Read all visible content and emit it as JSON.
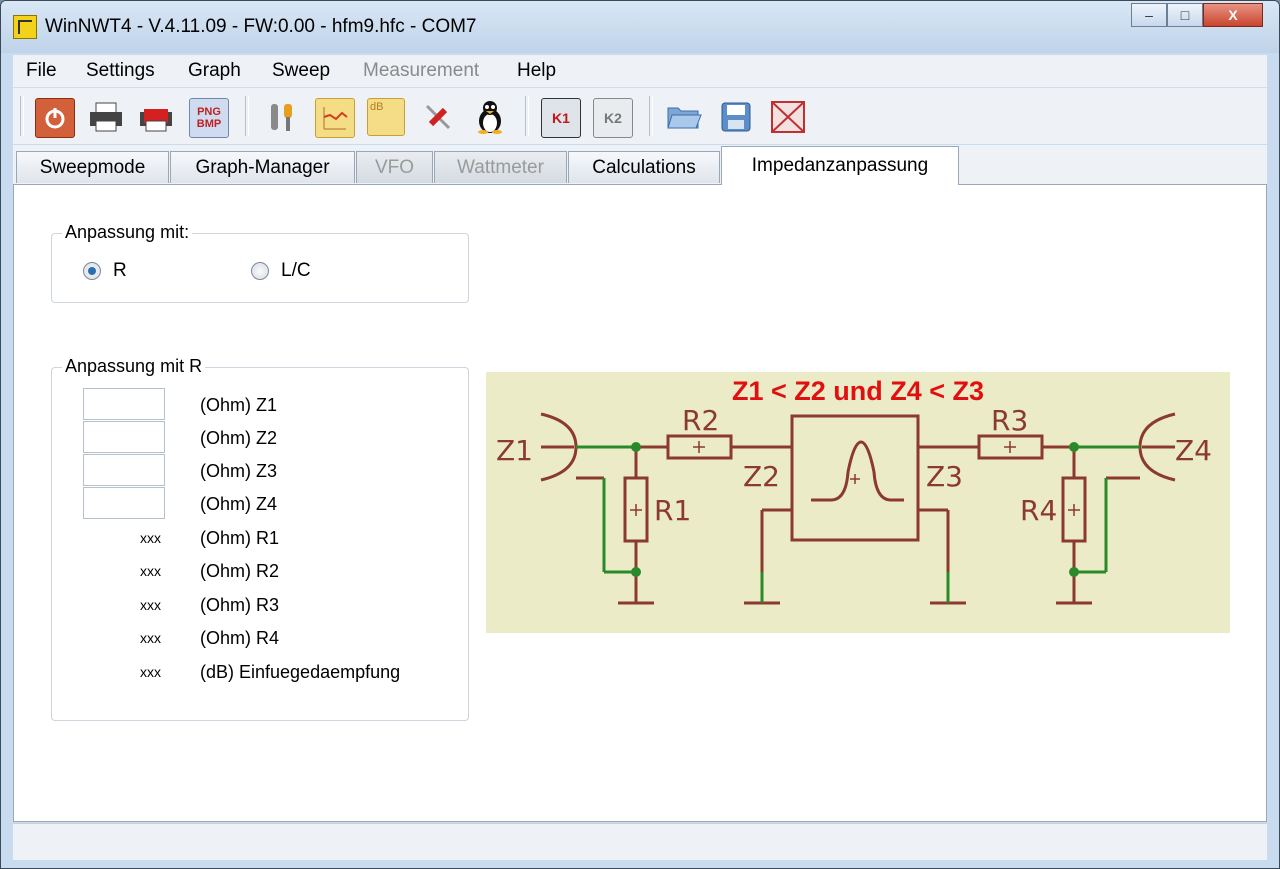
{
  "window": {
    "title": "WinNWT4 - V.4.11.09 - FW:0.00 - hfm9.hfc - COM7",
    "controls": {
      "minimize": "–",
      "maximize": "□",
      "close": "X"
    }
  },
  "menu": [
    "File",
    "Settings",
    "Graph",
    "Sweep",
    "Measurement",
    "Help"
  ],
  "toolbar": {
    "icons": [
      "power-icon",
      "printer-icon",
      "pdf-icon",
      "png-bmp-icon",
      "tools-icon",
      "graph-icon",
      "db-icon",
      "screwdriver-icon",
      "linux-icon",
      "k1-icon",
      "k2-icon",
      "open-folder-icon",
      "save-icon",
      "calibrate-icon"
    ],
    "png_label": "PNG",
    "bmp_label": "BMP",
    "db_label": "dB",
    "k1_label": "K1",
    "k2_label": "K2"
  },
  "tabs": [
    {
      "label": "Sweepmode",
      "state": "normal"
    },
    {
      "label": "Graph-Manager",
      "state": "normal"
    },
    {
      "label": "VFO",
      "state": "disabled"
    },
    {
      "label": "Wattmeter",
      "state": "disabled"
    },
    {
      "label": "Calculations",
      "state": "normal"
    },
    {
      "label": "Impedanzanpassung",
      "state": "active"
    }
  ],
  "match_group": {
    "title": "Anpassung mit:",
    "options": [
      {
        "label": "R",
        "selected": true
      },
      {
        "label": "L/C",
        "selected": false
      }
    ]
  },
  "r_group": {
    "title": "Anpassung mit R",
    "inputs": [
      {
        "value": "",
        "label": "(Ohm) Z1"
      },
      {
        "value": "",
        "label": "(Ohm) Z2"
      },
      {
        "value": "",
        "label": "(Ohm) Z3"
      },
      {
        "value": "",
        "label": "(Ohm) Z4"
      }
    ],
    "results": [
      {
        "value": "xxx",
        "label": "(Ohm) R1"
      },
      {
        "value": "xxx",
        "label": "(Ohm) R2"
      },
      {
        "value": "xxx",
        "label": "(Ohm) R3"
      },
      {
        "value": "xxx",
        "label": "(Ohm) R4"
      },
      {
        "value": "xxx",
        "label": "(dB) Einfuegedaempfung"
      }
    ]
  },
  "schematic": {
    "heading": "Z1 < Z2 und Z4 < Z3",
    "labels": {
      "z1": "Z1",
      "z2": "Z2",
      "z3": "Z3",
      "z4": "Z4",
      "r1": "R1",
      "r2": "R2",
      "r3": "R3",
      "r4": "R4"
    },
    "colors": {
      "background": "#ecebc7",
      "wire": "#8b3a2e",
      "net": "#2a8a2a",
      "heading": "#e01010"
    }
  }
}
